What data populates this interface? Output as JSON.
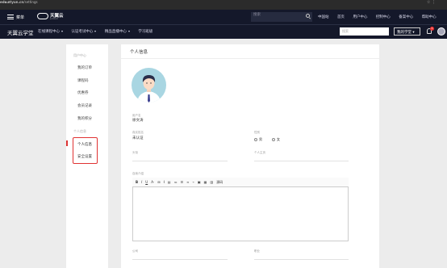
{
  "browser": {
    "url_prefix": "edu.ctyun.cn",
    "url_path": "/settings"
  },
  "header": {
    "menu_label": "菜单",
    "logo_text": "天翼云",
    "logo_sub": "e.Cloud",
    "search_placeholder": "搜索",
    "top_nav": [
      "中国站",
      "首页",
      "用户中心",
      "控制中心",
      "备案中心",
      "帮助中心"
    ]
  },
  "subheader": {
    "brand": "天翼云学堂",
    "nav": [
      "在线课程中心",
      "认证考试中心",
      "精品直播中心",
      "学习班级"
    ],
    "search_placeholder": "搜索",
    "study_button": "我的学堂",
    "badge_count": "1"
  },
  "sidebar": {
    "section1_head": "用户中心",
    "items1": [
      "我的订单",
      "课程码",
      "优惠券",
      "会员记录",
      "我的积分"
    ],
    "section2_head": "个人信息",
    "items2": [
      "个人信息",
      "安全设置"
    ]
  },
  "main": {
    "title": "个人信息",
    "username_label": "用户名",
    "username_value": "徐文涛",
    "realname_label": "真实姓名",
    "realname_value": "未认证",
    "gender_label": "性别",
    "gender_male": "男",
    "gender_female": "女",
    "company_label": "头衔",
    "personal_page_label": "个人主页",
    "bio_label": "自我介绍",
    "toolbar_source": "源码",
    "bottom_label_1": "公司",
    "bottom_label_2": "职业"
  }
}
